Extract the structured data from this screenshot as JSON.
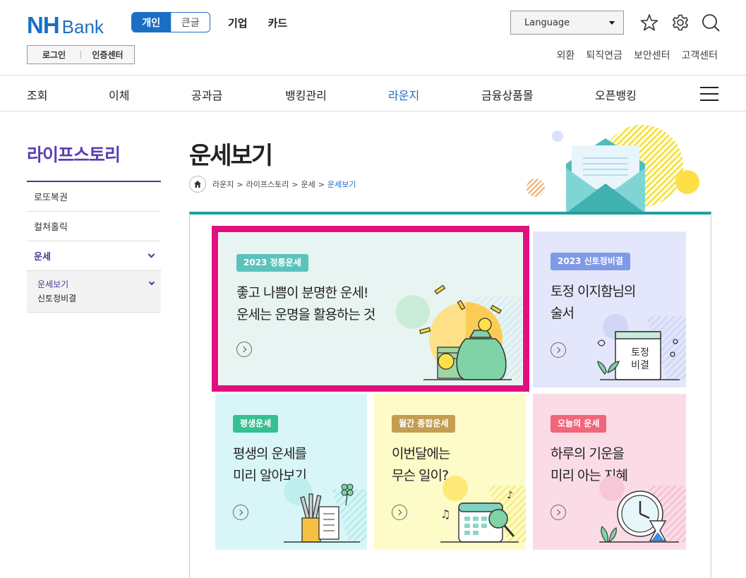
{
  "header": {
    "logo_nh": "NH",
    "logo_bank": "Bank",
    "segment": {
      "active": "개인",
      "inactive": "큰글"
    },
    "top_menu": [
      "기업",
      "카드"
    ],
    "language_label": "Language",
    "login": "로그인",
    "cert": "인증센터",
    "util_links": [
      "외환",
      "퇴직연금",
      "보안센터",
      "고객센터"
    ]
  },
  "gnb": [
    "조회",
    "이체",
    "공과금",
    "뱅킹관리",
    "라운지",
    "금융상품몰",
    "오픈뱅킹"
  ],
  "sidebar": {
    "title": "라이프스토리",
    "items": [
      "로또복권",
      "컬쳐홀릭",
      "운세"
    ],
    "sub_items": [
      "운세보기",
      "신토정비결"
    ]
  },
  "main": {
    "title": "운세보기",
    "breadcrumb": [
      "라운지",
      "라이프스토리",
      "운세",
      "운세보기"
    ]
  },
  "cards": [
    {
      "badge": "2023 정통운세",
      "line1": "좋고 나쁨이 분명한 운세!",
      "line2": "운세는 운명을 활용하는 것",
      "art_text": ""
    },
    {
      "badge": "2023 신토정비결",
      "line1": "토정 이지함님의",
      "line2": "술서",
      "art_text_1": "토정",
      "art_text_2": "비결"
    },
    {
      "badge": "평생운세",
      "line1": "평생의 운세를",
      "line2": "미리 알아보기"
    },
    {
      "badge": "월간 종합운세",
      "line1": "이번달에는",
      "line2": "무슨 일이?"
    },
    {
      "badge": "오늘의 운세",
      "line1": "하루의 기운을",
      "line2": "미리 아는 지혜"
    }
  ],
  "colors": {
    "brand": "#1a6fc4",
    "sidebar_title": "#5a3fb0",
    "teal": "#1fa09a",
    "highlight": "#e0107f"
  }
}
